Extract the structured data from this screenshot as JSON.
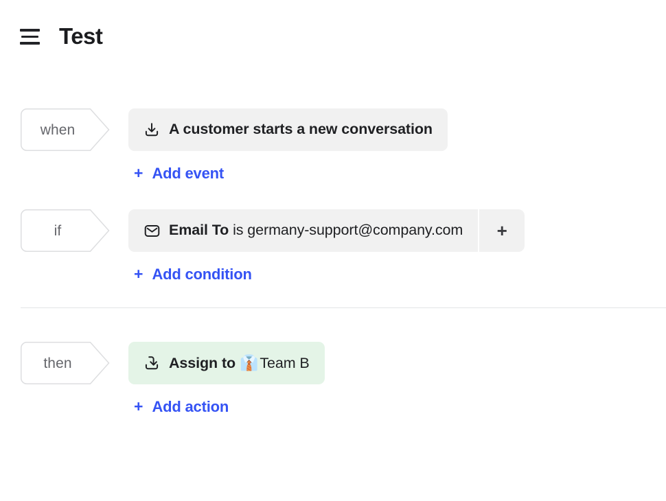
{
  "header": {
    "menu_icon": "hamburger-icon",
    "title": "Test"
  },
  "rules": {
    "when": {
      "tag_label": "when",
      "chip": {
        "icon": "download-tray-icon",
        "text": "A customer starts a new conversation"
      },
      "add_link": {
        "plus": "+",
        "label": "Add event"
      }
    },
    "if": {
      "tag_label": "if",
      "chip": {
        "icon": "envelope-icon",
        "field": "Email To",
        "operator": "is",
        "value": "germany-support@company.com",
        "plus_button": "+"
      },
      "add_link": {
        "plus": "+",
        "label": "Add condition"
      }
    },
    "then": {
      "tag_label": "then",
      "chip": {
        "icon": "assign-arrow-tray-icon",
        "action": "Assign to",
        "emoji": "👔",
        "target": "Team B"
      },
      "add_link": {
        "plus": "+",
        "label": "Add action"
      }
    }
  },
  "colors": {
    "accent_blue": "#3553f4",
    "chip_gray": "#f1f1f1",
    "chip_green": "#e4f4e7",
    "tag_border": "#dddee0",
    "divider": "#e3e4e6",
    "text_dark": "#1f2023",
    "tag_text": "#65666b"
  }
}
